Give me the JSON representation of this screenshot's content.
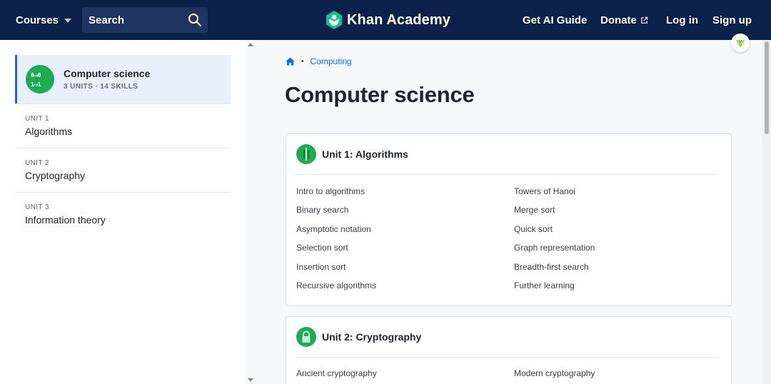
{
  "header": {
    "courses_label": "Courses",
    "search_label": "Search",
    "logo_text": "Khan Academy",
    "nav": {
      "ai_guide": "Get AI Guide",
      "donate": "Donate",
      "login": "Log in",
      "signup": "Sign up"
    }
  },
  "sidebar": {
    "course": {
      "title": "Computer science",
      "meta": "3 UNITS · 14 SKILLS",
      "icon_line1": "0⟶0",
      "icon_line2": "1⟶1"
    },
    "units": [
      {
        "label": "UNIT 1",
        "name": "Algorithms"
      },
      {
        "label": "UNIT 2",
        "name": "Cryptography"
      },
      {
        "label": "UNIT 3",
        "name": "Information theory"
      }
    ]
  },
  "breadcrumb": {
    "home_icon": "home-icon",
    "crumb": "Computing"
  },
  "page_title": "Computer science",
  "units": [
    {
      "title": "Unit 1: Algorithms",
      "icon": "algorithm-bars-icon",
      "lessons_left": [
        "Intro to algorithms",
        "Binary search",
        "Asymptotic notation",
        "Selection sort",
        "Insertion sort",
        "Recursive algorithms"
      ],
      "lessons_right": [
        "Towers of Hanoi",
        "Merge sort",
        "Quick sort",
        "Graph representation",
        "Breadth-first search",
        "Further learning"
      ]
    },
    {
      "title": "Unit 2: Cryptography",
      "icon": "padlock-icon",
      "lessons_left": [
        "Ancient cryptography"
      ],
      "lessons_right": [
        "Modern cryptography"
      ]
    }
  ],
  "colors": {
    "header_bg": "#0b2149",
    "accent_blue": "#1865f2",
    "brand_green": "#1fab54",
    "sidebar_active_bg": "#e8f0fd"
  }
}
